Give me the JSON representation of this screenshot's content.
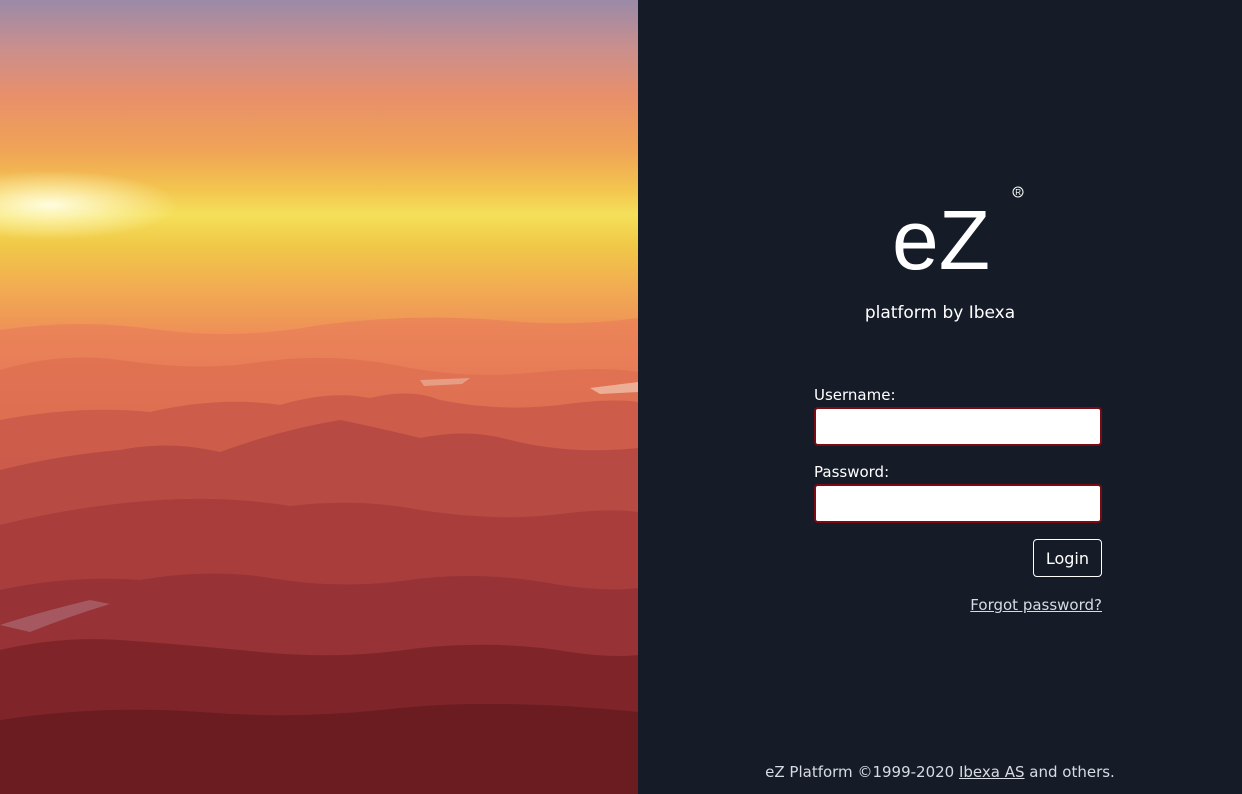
{
  "brand": {
    "logo_text": "eZ",
    "registered_mark": "®",
    "tagline": "platform by Ibexa"
  },
  "login_form": {
    "username_label": "Username:",
    "username_value": "",
    "password_label": "Password:",
    "password_value": "",
    "login_button": "Login",
    "forgot_link": "Forgot password?"
  },
  "footer": {
    "prefix": "eZ Platform ©1999-2020",
    "link": "Ibexa AS",
    "suffix": "and others."
  },
  "colors": {
    "panel_bg": "#151c28",
    "input_border": "#7a0a14",
    "text": "#ffffff"
  }
}
